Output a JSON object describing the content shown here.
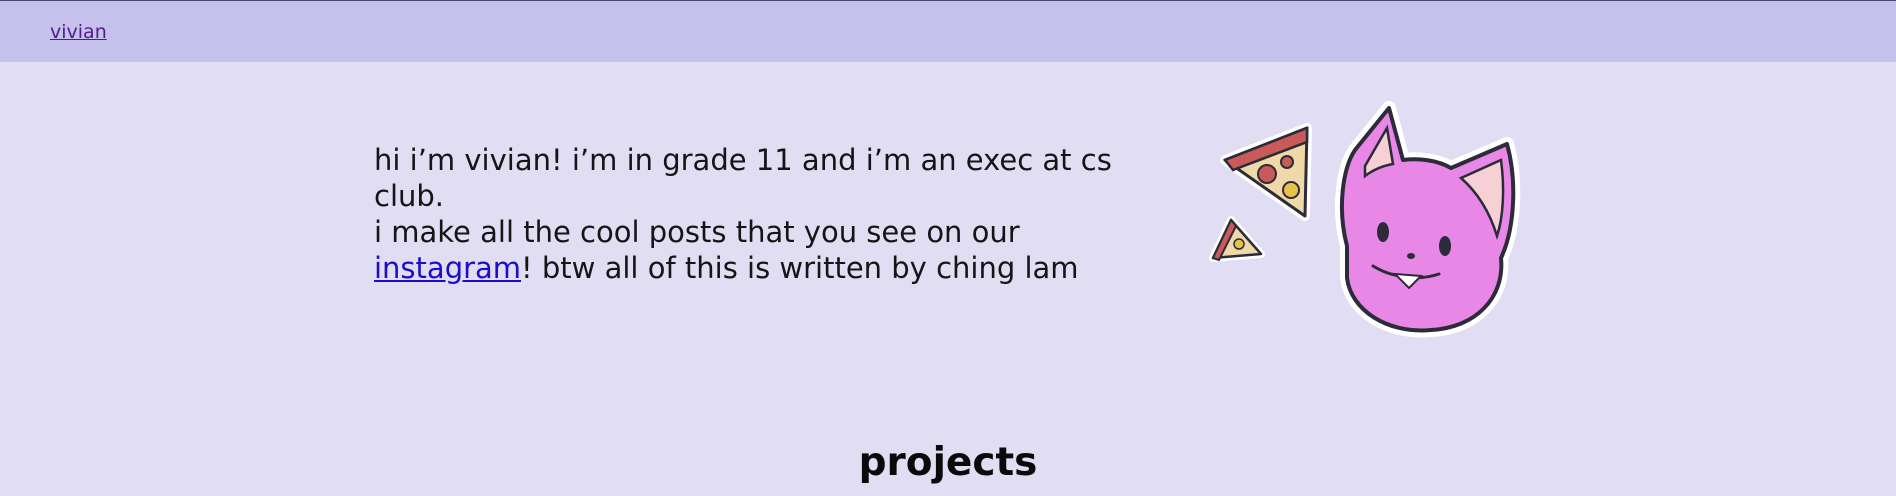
{
  "nav": {
    "home_link": "vivian"
  },
  "intro": {
    "line1": "hi i’m vivian! i’m in grade 11 and i’m an exec at cs club.",
    "line2": "i make all the cool posts that you see on our",
    "link_text": "instagram",
    "line3_rest": "! btw all of this is written by ching lam"
  },
  "illustration": {
    "icon": "cat-and-pizza-icon"
  },
  "projects": {
    "heading": "projects"
  },
  "colors": {
    "header_bg": "#c6c0ec",
    "page_bg": "#e1ddf3",
    "link": "#1a0dcc",
    "visited_link": "#551a8b",
    "cat_fill": "#e887e6"
  }
}
